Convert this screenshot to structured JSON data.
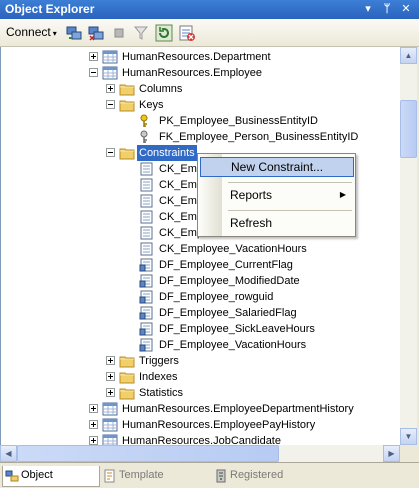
{
  "window": {
    "title": "Object Explorer",
    "pin_glyph": "▾",
    "autohide_glyph": "ᛘ",
    "close_glyph": "✕"
  },
  "toolbar": {
    "connect_label": "Connect",
    "connect_arrow": "▾",
    "icons": [
      "connect-icon",
      "disconnect-icon",
      "stop-icon",
      "filter-icon",
      "refresh-icon",
      "properties-icon"
    ]
  },
  "tree": {
    "items": [
      {
        "label": "HumanResources.Department",
        "icon": "table-icon",
        "expander": "plus",
        "selected": false
      },
      {
        "label": "HumanResources.Employee",
        "icon": "table-icon",
        "expander": "minus",
        "selected": false
      },
      {
        "label": "Columns",
        "icon": "folder-icon",
        "expander": "plus",
        "selected": false
      },
      {
        "label": "Keys",
        "icon": "folder-icon",
        "expander": "minus",
        "selected": false
      },
      {
        "label": "PK_Employee_BusinessEntityID",
        "icon": "primary-key-icon",
        "expander": "none",
        "selected": false
      },
      {
        "label": "FK_Employee_Person_BusinessEntityID",
        "icon": "foreign-key-icon",
        "expander": "none",
        "selected": false
      },
      {
        "label": "Constraints",
        "icon": "folder-icon",
        "expander": "minus",
        "selected": true
      },
      {
        "label": "CK_Emp",
        "icon": "check-constraint-icon",
        "expander": "none",
        "selected": false
      },
      {
        "label": "CK_Emp",
        "icon": "check-constraint-icon",
        "expander": "none",
        "selected": false
      },
      {
        "label": "CK_Emp",
        "icon": "check-constraint-icon",
        "expander": "none",
        "selected": false
      },
      {
        "label": "CK_Emp",
        "icon": "check-constraint-icon",
        "expander": "none",
        "selected": false
      },
      {
        "label": "CK_Emp",
        "icon": "check-constraint-icon",
        "expander": "none",
        "selected": false
      },
      {
        "label": "CK_Employee_VacationHours",
        "icon": "check-constraint-icon",
        "expander": "none",
        "selected": false
      },
      {
        "label": "DF_Employee_CurrentFlag",
        "icon": "default-constraint-icon",
        "expander": "none",
        "selected": false
      },
      {
        "label": "DF_Employee_ModifiedDate",
        "icon": "default-constraint-icon",
        "expander": "none",
        "selected": false
      },
      {
        "label": "DF_Employee_rowguid",
        "icon": "default-constraint-icon",
        "expander": "none",
        "selected": false
      },
      {
        "label": "DF_Employee_SalariedFlag",
        "icon": "default-constraint-icon",
        "expander": "none",
        "selected": false
      },
      {
        "label": "DF_Employee_SickLeaveHours",
        "icon": "default-constraint-icon",
        "expander": "none",
        "selected": false
      },
      {
        "label": "DF_Employee_VacationHours",
        "icon": "default-constraint-icon",
        "expander": "none",
        "selected": false
      },
      {
        "label": "Triggers",
        "icon": "folder-icon",
        "expander": "plus",
        "selected": false
      },
      {
        "label": "Indexes",
        "icon": "folder-icon",
        "expander": "plus",
        "selected": false
      },
      {
        "label": "Statistics",
        "icon": "folder-icon",
        "expander": "plus",
        "selected": false
      },
      {
        "label": "HumanResources.EmployeeDepartmentHistory",
        "icon": "table-icon",
        "expander": "plus",
        "selected": false
      },
      {
        "label": "HumanResources.EmployeePayHistory",
        "icon": "table-icon",
        "expander": "plus",
        "selected": false
      },
      {
        "label": "HumanResources.JobCandidate",
        "icon": "table-icon",
        "expander": "plus",
        "selected": false
      }
    ]
  },
  "context_menu": {
    "items": [
      {
        "label": "New Constraint...",
        "highlighted": true,
        "submenu": false
      },
      {
        "label": "Reports",
        "highlighted": false,
        "submenu": true
      },
      {
        "label": "Refresh",
        "highlighted": false,
        "submenu": false
      }
    ],
    "submenu_glyph": "▶"
  },
  "scrollbar": {
    "up_glyph": "▲",
    "down_glyph": "▼",
    "left_glyph": "◀",
    "right_glyph": "▶"
  },
  "bottom_tabs": [
    {
      "label": "Object Explorer",
      "icon": "object-explorer-icon",
      "active": true
    },
    {
      "label": "Template Explorer",
      "icon": "template-explorer-icon",
      "active": false
    },
    {
      "label": "Registered Servers",
      "icon": "registered-servers-icon",
      "active": false
    }
  ],
  "colors": {
    "title_bar": "#2a63bd",
    "selection": "#316ac5",
    "menu_highlight": "#c1d2ee",
    "folder": "#f3cf6b"
  }
}
